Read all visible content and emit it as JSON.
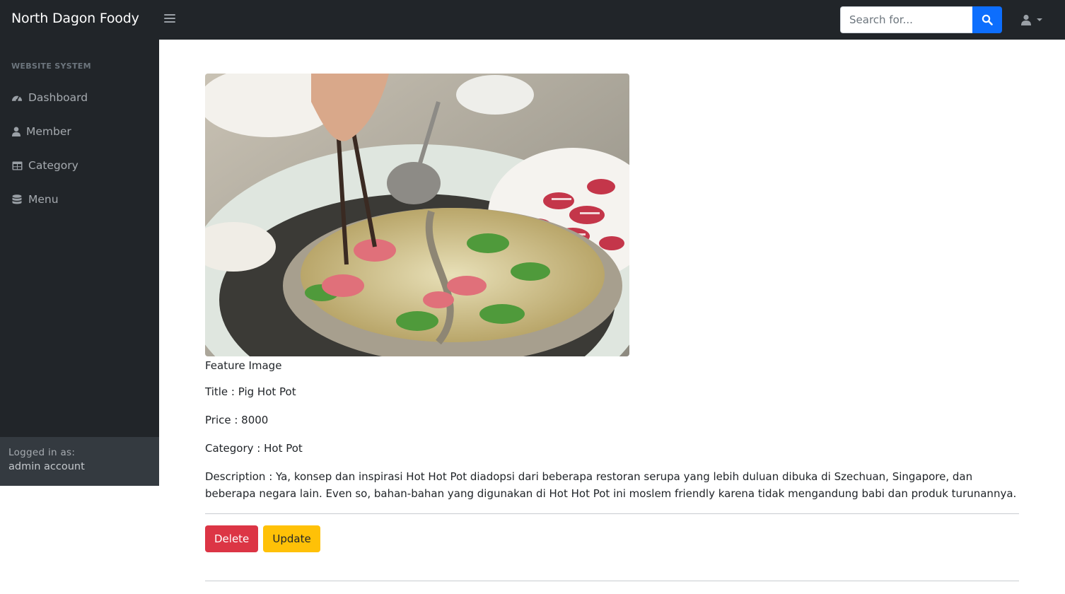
{
  "navbar": {
    "brand": "North Dagon Foody",
    "search_placeholder": "Search for..."
  },
  "sidebar": {
    "heading": "WEBSITE SYSTEM",
    "items": [
      {
        "label": "Dashboard",
        "icon": "tachometer-icon"
      },
      {
        "label": "Member",
        "icon": "user-icon"
      },
      {
        "label": "Category",
        "icon": "table-icon"
      },
      {
        "label": "Menu",
        "icon": "database-icon"
      }
    ],
    "footer": {
      "logged_in_label": "Logged in as:",
      "user": "admin account"
    }
  },
  "detail": {
    "image_caption": "Feature Image",
    "title": "Title : Pig Hot Pot",
    "price": "Price : 8000",
    "category": "Category : Hot Pot",
    "description": "Description : Ya, konsep dan inspirasi Hot Hot Pot diadopsi dari beberapa restoran serupa yang lebih duluan dibuka di Szechuan, Singapore, dan beberapa negara lain. Even so, bahan-bahan yang digunakan di Hot Hot Pot ini moslem friendly karena tidak mengandung babi dan produk turunannya."
  },
  "actions": {
    "delete_label": "Delete",
    "update_label": "Update"
  },
  "colors": {
    "navbar_bg": "#212529",
    "primary": "#0d6efd",
    "danger": "#dc3545",
    "warning": "#ffc107"
  }
}
